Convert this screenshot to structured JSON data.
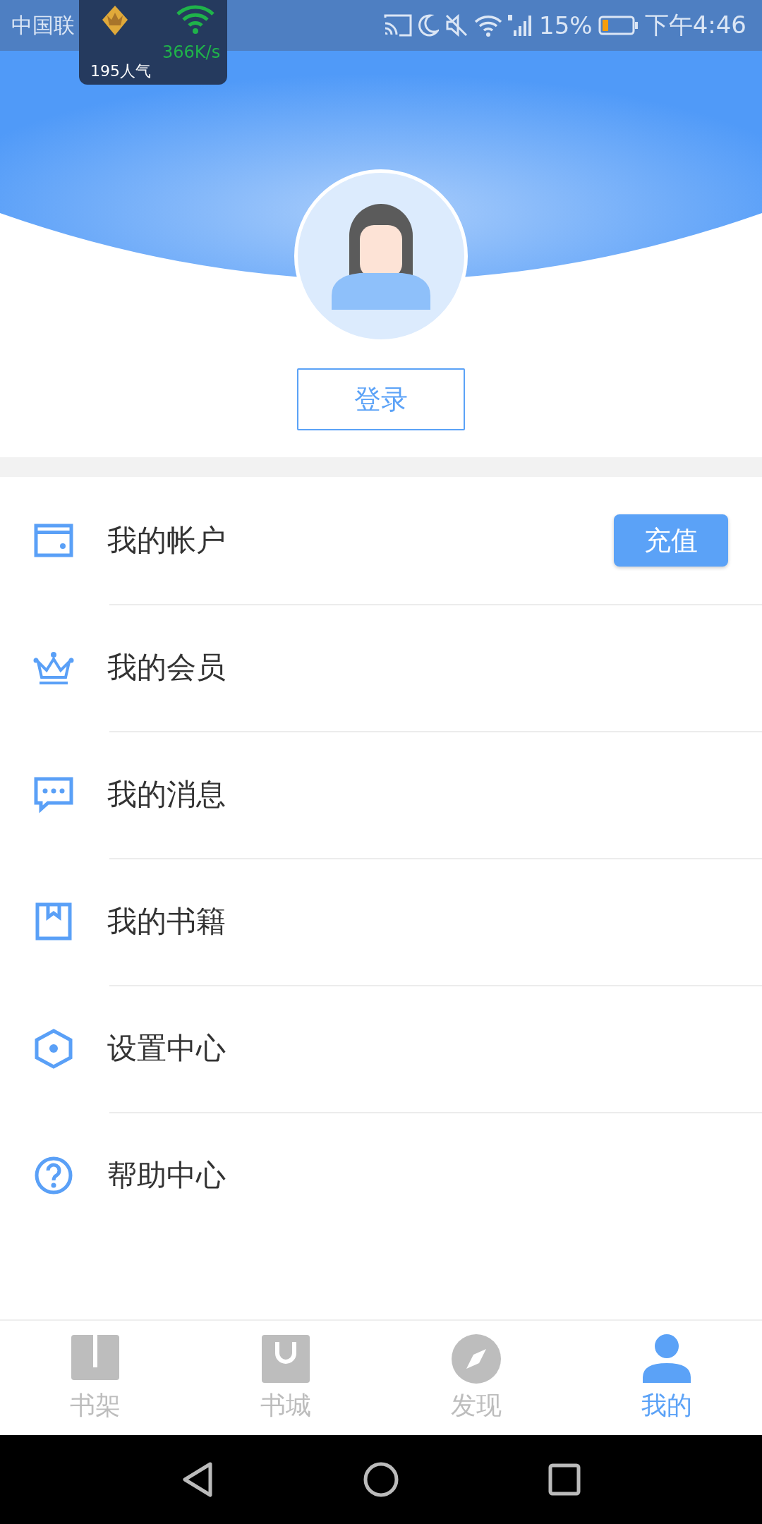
{
  "status_bar": {
    "carrier": "中国联",
    "battery": "15%",
    "time": "下午4:46"
  },
  "overlay": {
    "speed": "366K/s",
    "popularity": "195人气"
  },
  "login_button": "登录",
  "menu": [
    {
      "label": "我的帐户",
      "action": "充值"
    },
    {
      "label": "我的会员"
    },
    {
      "label": "我的消息"
    },
    {
      "label": "我的书籍"
    },
    {
      "label": "设置中心"
    },
    {
      "label": "帮助中心"
    }
  ],
  "tabs": [
    {
      "label": "书架",
      "selected": false
    },
    {
      "label": "书城",
      "selected": false
    },
    {
      "label": "发现",
      "selected": false
    },
    {
      "label": "我的",
      "selected": true
    }
  ]
}
